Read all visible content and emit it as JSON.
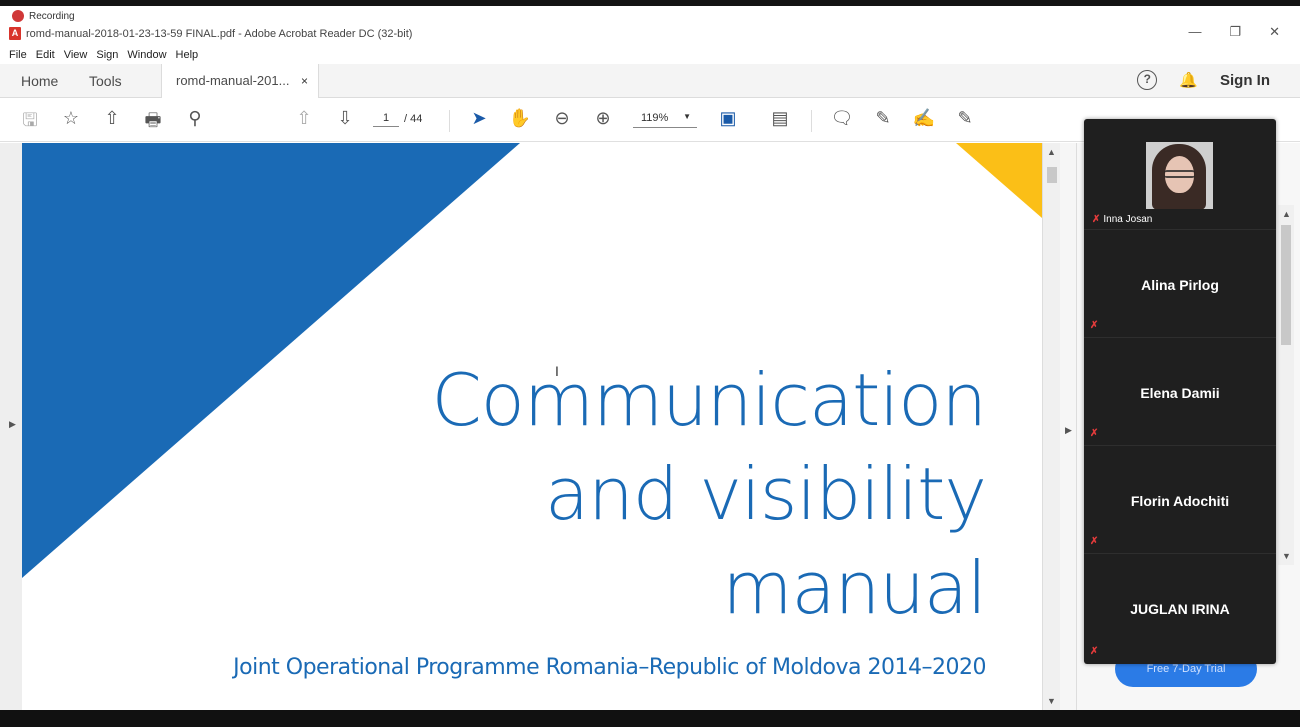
{
  "recording": {
    "label": "Recording"
  },
  "window": {
    "title": "romd-manual-2018-01-23-13-59 FINAL.pdf - Adobe Acrobat Reader DC (32-bit)",
    "pdf_badge": "A",
    "controls": {
      "minimize": "—",
      "restore": "❐",
      "close": "✕"
    }
  },
  "menu": [
    "File",
    "Edit",
    "View",
    "Sign",
    "Window",
    "Help"
  ],
  "tabs": {
    "home": "Home",
    "tools": "Tools",
    "document": "romd-manual-201...",
    "close": "×"
  },
  "header": {
    "help": "?",
    "sign_in": "Sign In"
  },
  "toolbar": {
    "page_current": "1",
    "page_total": "/ 44",
    "zoom": "119%"
  },
  "document": {
    "title_lines": [
      "Communication",
      "and visibility",
      "manual"
    ],
    "subtitle": "Joint Operational Programme Romania–Republic of Moldova 2014–2020",
    "colors": {
      "blue": "#1a6ab5",
      "yellow": "#fbbf17"
    }
  },
  "right_pane": {
    "trial_button": "Free 7-Day Trial"
  },
  "participants": {
    "self": {
      "name": "Inna Josan",
      "muted": true
    },
    "others": [
      {
        "name": "Alina Pirlog",
        "muted": true
      },
      {
        "name": "Elena Damii",
        "muted": true
      },
      {
        "name": "Florin Adochiti",
        "muted": true
      },
      {
        "name": "JUGLAN IRINA",
        "muted": true
      }
    ]
  },
  "icons": {
    "mic_off": "mic-off-icon",
    "save": "save-icon",
    "star": "star-icon",
    "upload": "upload-icon",
    "print": "print-icon",
    "search": "search-icon"
  }
}
